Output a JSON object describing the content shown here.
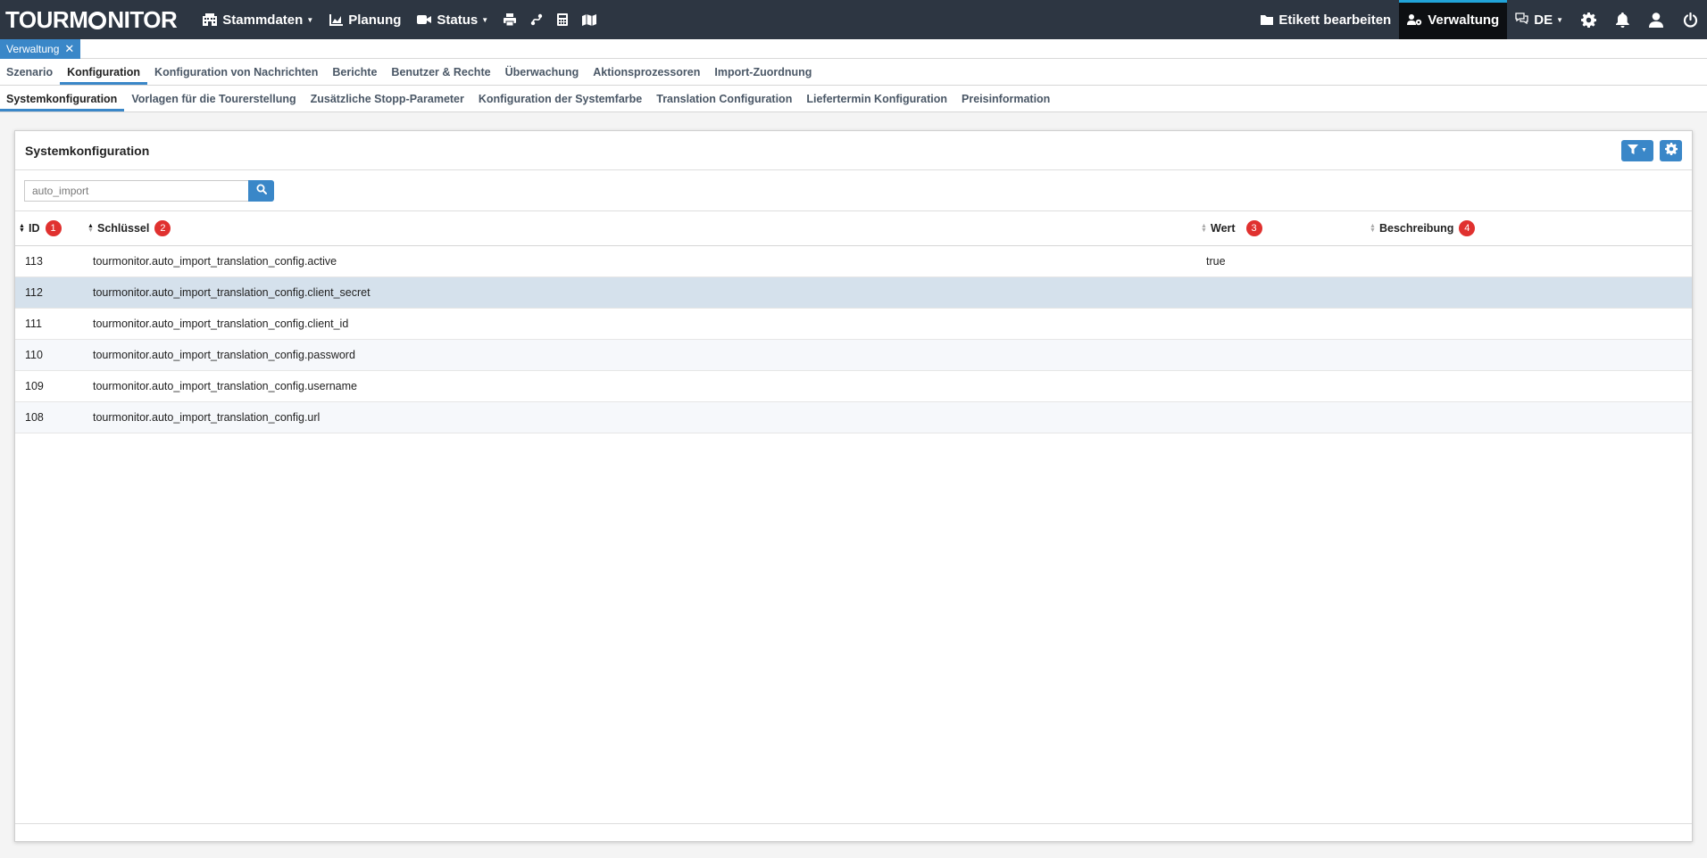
{
  "app": {
    "logo_left": "TOURM",
    "logo_right": "NITOR"
  },
  "nav": {
    "stammdaten": "Stammdaten",
    "planung": "Planung",
    "status": "Status",
    "etikett": "Etikett bearbeiten",
    "verwaltung": "Verwaltung",
    "lang": "DE"
  },
  "open_tabs": [
    {
      "label": "Verwaltung",
      "close": "✕"
    }
  ],
  "menu1": [
    {
      "label": "Szenario"
    },
    {
      "label": "Konfiguration"
    },
    {
      "label": "Konfiguration von Nachrichten"
    },
    {
      "label": "Berichte"
    },
    {
      "label": "Benutzer & Rechte"
    },
    {
      "label": "Überwachung"
    },
    {
      "label": "Aktionsprozessoren"
    },
    {
      "label": "Import-Zuordnung"
    }
  ],
  "menu2": [
    {
      "label": "Systemkonfiguration"
    },
    {
      "label": "Vorlagen für die Tourerstellung"
    },
    {
      "label": "Zusätzliche Stopp-Parameter"
    },
    {
      "label": "Konfiguration der Systemfarbe"
    },
    {
      "label": "Translation Configuration"
    },
    {
      "label": "Liefertermin Konfiguration"
    },
    {
      "label": "Preisinformation"
    }
  ],
  "panel": {
    "title": "Systemkonfiguration"
  },
  "search": {
    "value": "auto_import"
  },
  "table": {
    "columns": [
      {
        "label": "ID",
        "badge": "1"
      },
      {
        "label": "Schlüssel",
        "badge": "2"
      },
      {
        "label": "Wert",
        "badge": "3"
      },
      {
        "label": "Beschreibung",
        "badge": "4"
      }
    ],
    "rows": [
      {
        "id": "113",
        "key": "tourmonitor.auto_import_translation_config.active",
        "value": "true",
        "desc": ""
      },
      {
        "id": "112",
        "key": "tourmonitor.auto_import_translation_config.client_secret",
        "value": "",
        "desc": ""
      },
      {
        "id": "111",
        "key": "tourmonitor.auto_import_translation_config.client_id",
        "value": "",
        "desc": ""
      },
      {
        "id": "110",
        "key": "tourmonitor.auto_import_translation_config.password",
        "value": "",
        "desc": ""
      },
      {
        "id": "109",
        "key": "tourmonitor.auto_import_translation_config.username",
        "value": "",
        "desc": ""
      },
      {
        "id": "108",
        "key": "tourmonitor.auto_import_translation_config.url",
        "value": "",
        "desc": ""
      }
    ]
  },
  "colors": {
    "navbar": "#2d3642",
    "accent": "#3a87c8",
    "badge": "#e0312f",
    "selected_row": "#d5e1ec"
  }
}
